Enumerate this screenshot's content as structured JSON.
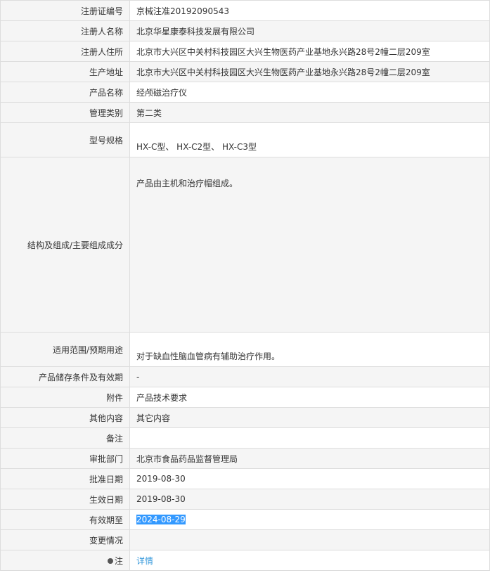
{
  "rows": [
    {
      "label": "注册证编号",
      "value": "京械注准20192090543"
    },
    {
      "label": "注册人名称",
      "value": "北京华星康泰科技发展有限公司"
    },
    {
      "label": "注册人住所",
      "value": "北京市大兴区中关村科技园区大兴生物医药产业基地永兴路28号2幢二层209室"
    },
    {
      "label": "生产地址",
      "value": "北京市大兴区中关村科技园区大兴生物医药产业基地永兴路28号2幢二层209室"
    },
    {
      "label": "产品名称",
      "value": "经颅磁治疗仪"
    },
    {
      "label": "管理类别",
      "value": "第二类"
    },
    {
      "label": "型号规格",
      "value": "HX-C型、 HX-C2型、 HX-C3型"
    },
    {
      "label": "结构及组成/主要组成成分",
      "value": "产品由主机和治疗帽组成。"
    },
    {
      "label": "适用范围/预期用途",
      "value": "对于缺血性脑血管病有辅助治疗作用。"
    },
    {
      "label": "产品储存条件及有效期",
      "value": "-"
    },
    {
      "label": "附件",
      "value": "产品技术要求"
    },
    {
      "label": "其他内容",
      "value": "其它内容"
    },
    {
      "label": "备注",
      "value": ""
    },
    {
      "label": "审批部门",
      "value": "北京市食品药品监督管理局"
    },
    {
      "label": "批准日期",
      "value": "2019-08-30"
    },
    {
      "label": "生效日期",
      "value": "2019-08-30"
    },
    {
      "label": "有效期至",
      "value": "2024-08-29"
    },
    {
      "label": "变更情况",
      "value": ""
    },
    {
      "label": "注",
      "value": "详情",
      "icon": "pin-icon"
    }
  ],
  "colors": {
    "label_bg": "#f5f5f5",
    "border": "#dddddd",
    "link": "#3498db",
    "selection": "#3399ff"
  }
}
